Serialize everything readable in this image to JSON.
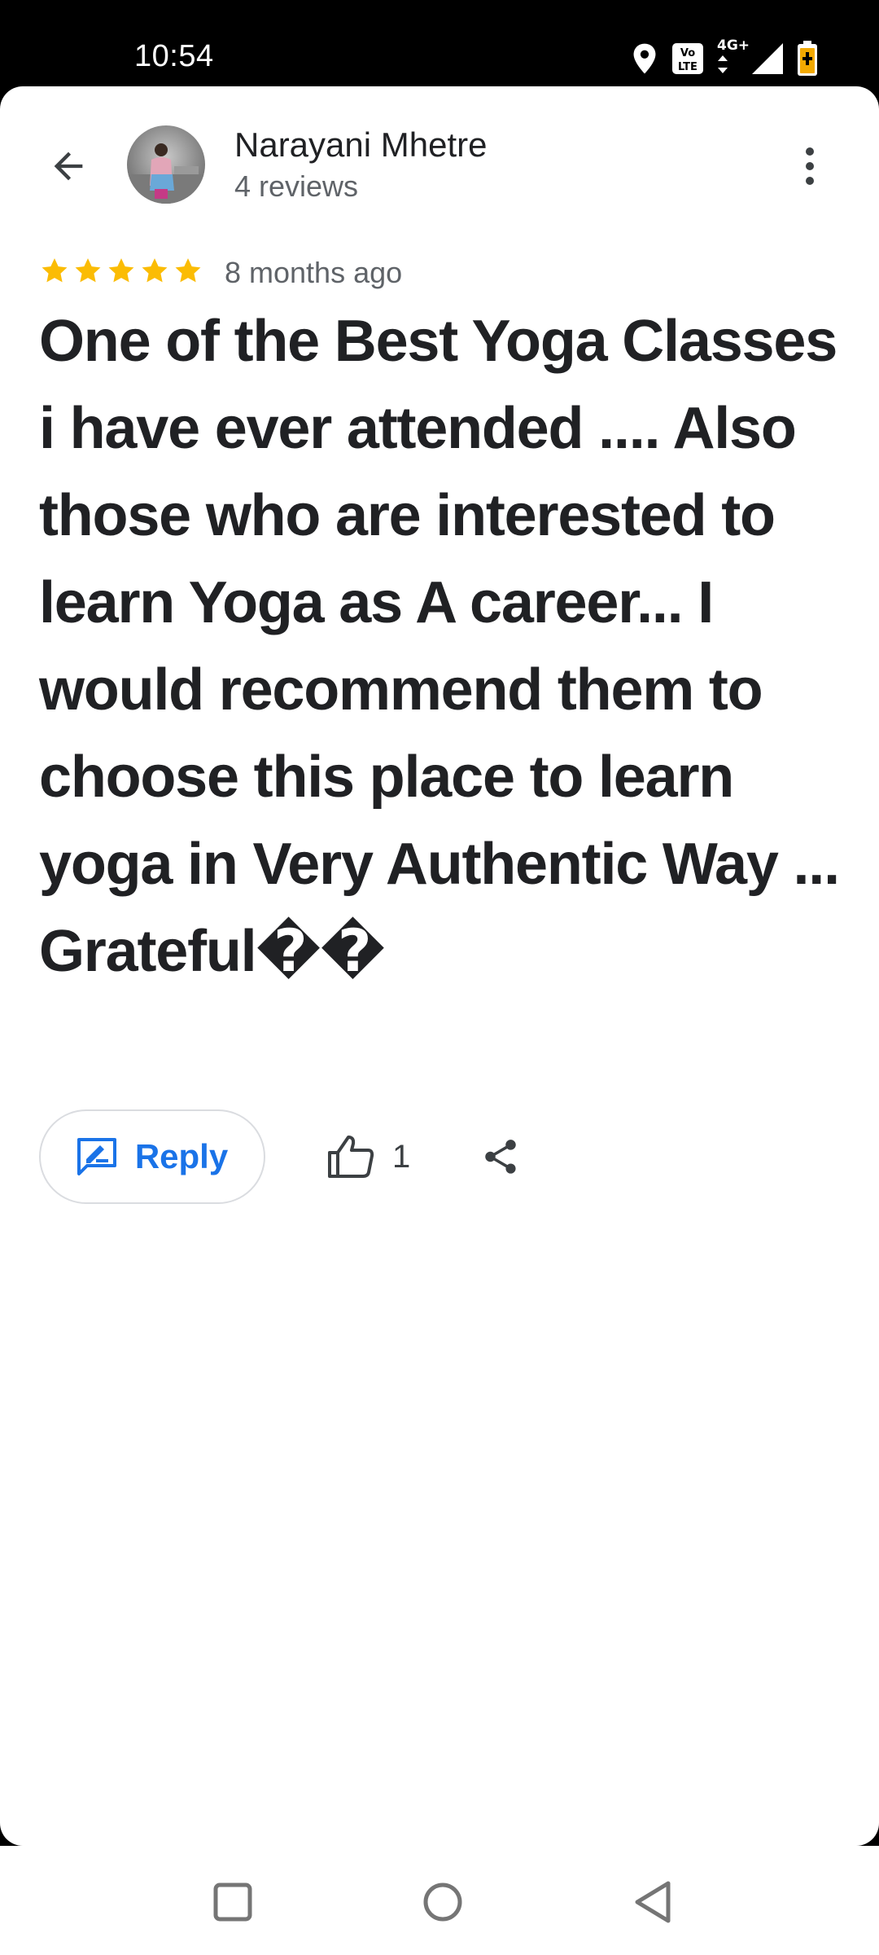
{
  "status_bar": {
    "time": "10:54",
    "icons": [
      "location-icon",
      "volte-icon",
      "network-4g-icon",
      "signal-icon",
      "battery-icon"
    ],
    "network_label": "4G+"
  },
  "header": {
    "reviewer_name": "Narayani Mhetre",
    "review_count": "4 reviews"
  },
  "review": {
    "rating": 5,
    "time_ago": "8 months ago",
    "text": "One of the Best Yoga Classes i have ever attended .... Also those who are interested to learn Yoga as A career... I would recommend them to choose this place to learn yoga in Very Authentic Way ... Grateful��"
  },
  "actions": {
    "reply_label": "Reply",
    "like_count": "1"
  },
  "nav": {
    "items": [
      "recents-icon",
      "home-icon",
      "back-icon"
    ]
  },
  "colors": {
    "star": "#FBBC04",
    "accent": "#1A73E8",
    "text_primary": "#202124",
    "text_secondary": "#5F6368"
  }
}
